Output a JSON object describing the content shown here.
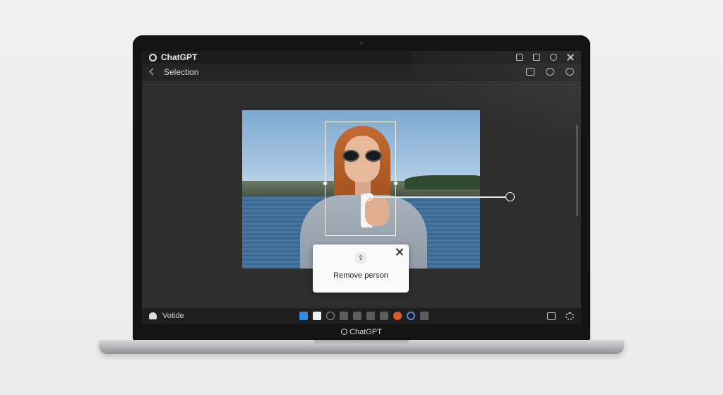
{
  "window": {
    "app_title": "ChatGPT"
  },
  "toolbar": {
    "title": "Selection"
  },
  "popup": {
    "action_label": "Remove person"
  },
  "bottombar": {
    "label": "Votide"
  },
  "bezel": {
    "label": "ChatGPT"
  },
  "icons": {
    "title_controls": [
      "share-icon",
      "copy-icon",
      "refresh-icon",
      "close-icon"
    ],
    "toolbar_tools": [
      "present-icon",
      "link-icon",
      "magic-icon"
    ],
    "bottom_tools": [
      "select-tool-icon",
      "brush-tool-icon",
      "eraser-tool-icon",
      "image-tool-icon",
      "pen-tool-icon",
      "shape-tool-icon",
      "stamp-tool-icon",
      "color-tool-icon",
      "ring-tool-icon",
      "grid-tool-icon"
    ],
    "bottom_right": [
      "comment-icon",
      "settings-icon"
    ]
  },
  "colors": {
    "accent": "#2f8de4",
    "screen_bg": "#2e2e2e"
  }
}
